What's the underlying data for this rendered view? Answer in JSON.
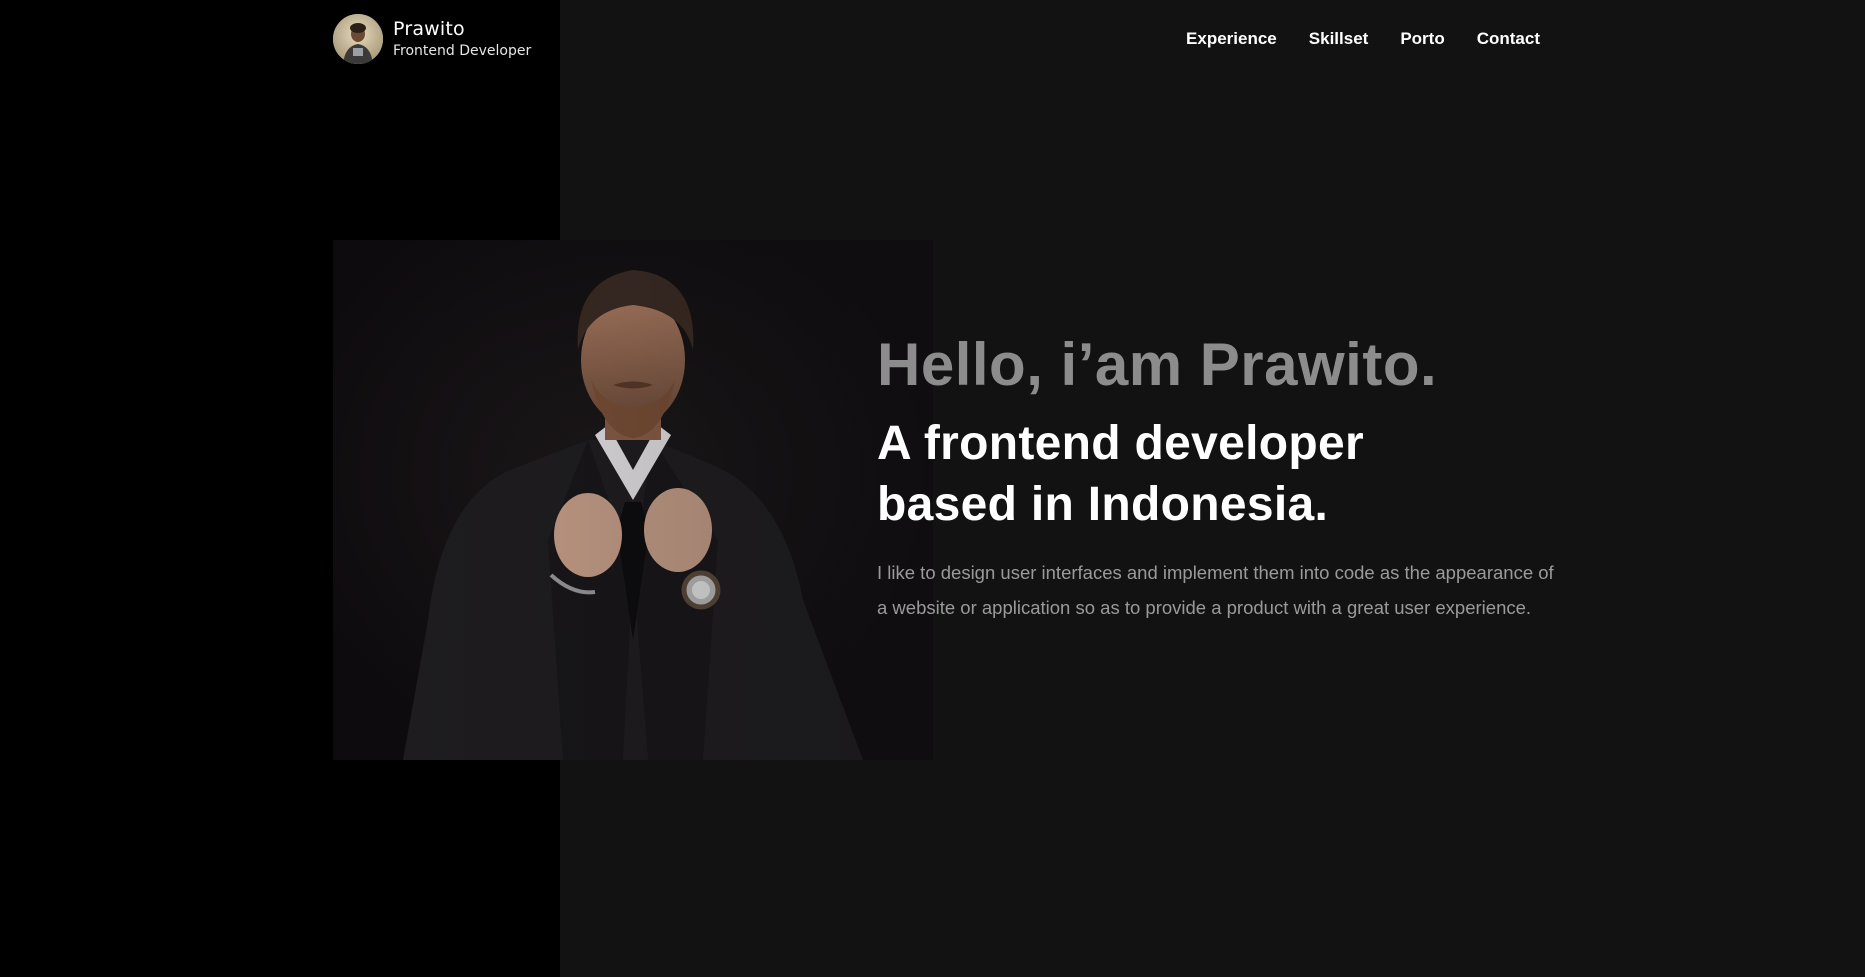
{
  "brand": {
    "name": "Prawito",
    "role": "Frontend Developer",
    "avatar_icon": "avatar-photo"
  },
  "nav": {
    "items": [
      {
        "label": "Experience"
      },
      {
        "label": "Skillset"
      },
      {
        "label": "Porto"
      },
      {
        "label": "Contact"
      }
    ]
  },
  "hero": {
    "greeting": "Hello, i’am Prawito.",
    "headline": "A frontend developer based in Indonesia.",
    "intro": "I like to design user interfaces and implement them into code as the appearance of a website or application so as to provide a product with a great user experience.",
    "image": "portrait-man-in-suit"
  },
  "colors": {
    "background": "#121213",
    "left_band": "#000000",
    "greeting_text": "#8c8c8c",
    "headline_text": "#ffffff",
    "body_text": "#9a9a9a"
  }
}
